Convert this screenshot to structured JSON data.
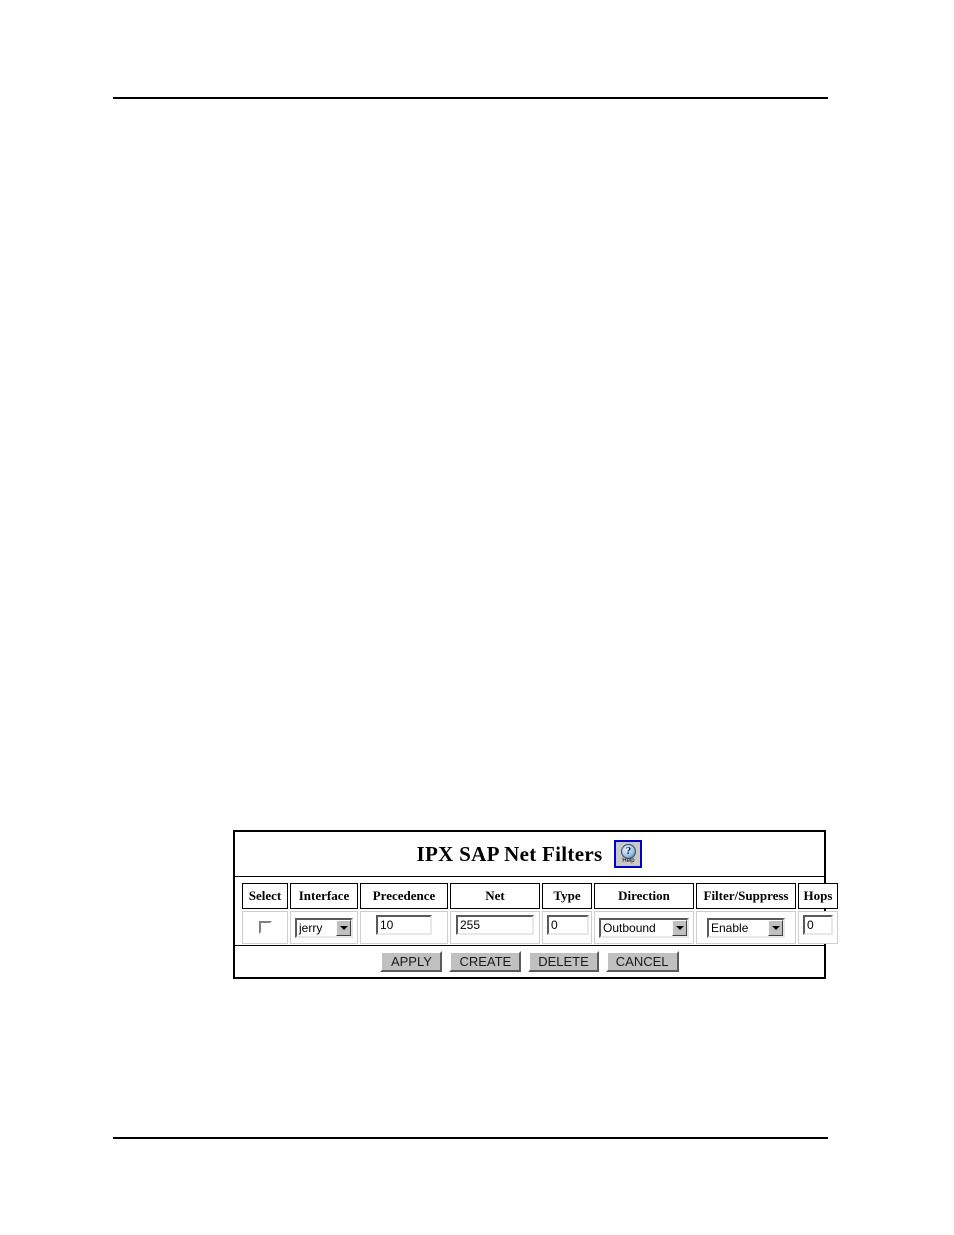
{
  "page": {
    "header_rule": "",
    "footer_rule": ""
  },
  "panel": {
    "title": "IPX SAP Net Filters",
    "help": {
      "glyph": "?",
      "label": "Help",
      "icon_name": "help-icon",
      "border_color": "#0000cc"
    },
    "table": {
      "headers": [
        "Select",
        "Interface",
        "Precedence",
        "Net",
        "Type",
        "Direction",
        "Filter/Suppress",
        "Hops"
      ],
      "rows": [
        {
          "select": {
            "type": "checkbox",
            "checked": false
          },
          "interface": {
            "type": "select",
            "value": "jerry"
          },
          "precedence": {
            "type": "text",
            "value": "10"
          },
          "net": {
            "type": "text",
            "value": "255"
          },
          "net_type": {
            "type": "text",
            "value": "0"
          },
          "direction": {
            "type": "select",
            "value": "Outbound"
          },
          "filter_suppress": {
            "type": "select",
            "value": "Enable"
          },
          "hops": {
            "type": "text",
            "value": "0"
          }
        }
      ]
    },
    "buttons": [
      {
        "label": "APPLY"
      },
      {
        "label": "CREATE"
      },
      {
        "label": "DELETE"
      },
      {
        "label": "CANCEL"
      }
    ]
  },
  "colors": {
    "button_face": "#c0c0c0",
    "border": "#000000",
    "help_border": "#0000cc",
    "text": "#000000"
  }
}
